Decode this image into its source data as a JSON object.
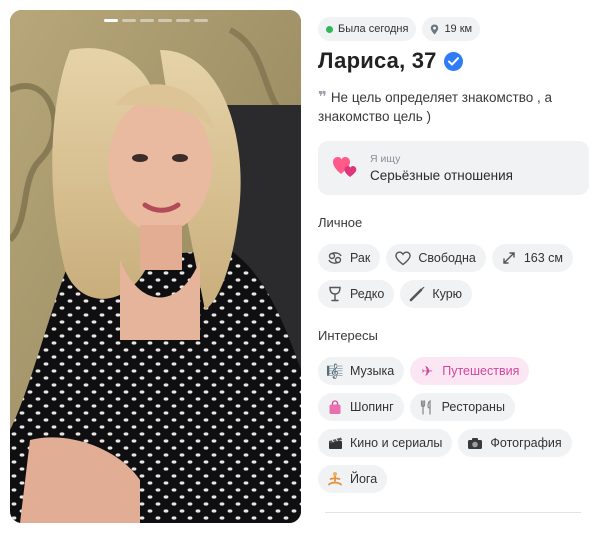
{
  "photo": {
    "pages": 6,
    "active_page": 1
  },
  "status": {
    "online_label": "Была сегодня",
    "distance_label": "19 км"
  },
  "profile": {
    "name_age": "Лариса, 37",
    "verified": true,
    "quote": "Не цель определяет знакомство , а знакомство цель )"
  },
  "looking_for": {
    "small_label": "Я ищу",
    "value": "Серьёзные отношения"
  },
  "personal": {
    "title": "Личное",
    "chips": [
      {
        "icon": "zodiac-cancer-icon",
        "label": "Рак"
      },
      {
        "icon": "heart-outline-icon",
        "label": "Свободна"
      },
      {
        "icon": "height-arrows-icon",
        "label": "163 см"
      },
      {
        "icon": "wine-glass-icon",
        "label": "Редко"
      },
      {
        "icon": "smoking-icon",
        "label": "Курю"
      }
    ]
  },
  "interests": {
    "title": "Интересы",
    "chips": [
      {
        "icon": "music-icon",
        "label": "Музыка",
        "highlighted": false
      },
      {
        "icon": "airplane-icon",
        "label": "Путешествия",
        "highlighted": true
      },
      {
        "icon": "shopping-bag-icon",
        "label": "Шопинг",
        "highlighted": false
      },
      {
        "icon": "cutlery-icon",
        "label": "Рестораны",
        "highlighted": false
      },
      {
        "icon": "clapperboard-icon",
        "label": "Кино и сериалы",
        "highlighted": false
      },
      {
        "icon": "camera-icon",
        "label": "Фотография",
        "highlighted": false
      },
      {
        "icon": "yoga-icon",
        "label": "Йога",
        "highlighted": false
      }
    ]
  },
  "colors": {
    "accent_pink": "#d2479c",
    "verified_blue": "#2f7cf6",
    "online_green": "#2fb75a",
    "chip_bg": "#f1f2f4"
  }
}
